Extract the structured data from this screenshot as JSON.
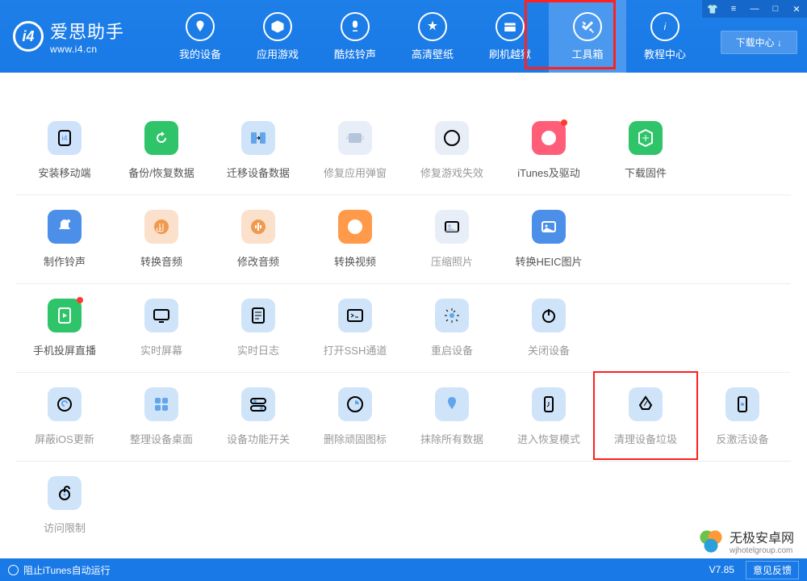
{
  "app": {
    "title": "爱思助手",
    "subtitle": "www.i4.cn"
  },
  "nav": [
    {
      "label": "我的设备"
    },
    {
      "label": "应用游戏"
    },
    {
      "label": "酷炫铃声"
    },
    {
      "label": "高清壁纸"
    },
    {
      "label": "刷机越狱"
    },
    {
      "label": "工具箱"
    },
    {
      "label": "教程中心"
    }
  ],
  "downloadCenter": "下载中心 ↓",
  "rows": [
    [
      {
        "label": "安装移动端",
        "bg": "c-blue-l",
        "icon": "install"
      },
      {
        "label": "备份/恢复数据",
        "bg": "c-green",
        "icon": "backup"
      },
      {
        "label": "迁移设备数据",
        "bg": "c-cyan-l",
        "icon": "migrate"
      },
      {
        "label": "修复应用弹窗",
        "bg": "c-gray",
        "icon": "appleid",
        "dim": true
      },
      {
        "label": "修复游戏失效",
        "bg": "c-gray",
        "icon": "game",
        "dim": true
      },
      {
        "label": "iTunes及驱动",
        "bg": "c-pink",
        "icon": "itunes",
        "dot": true
      },
      {
        "label": "下载固件",
        "bg": "c-green",
        "icon": "firmware"
      }
    ],
    [
      {
        "label": "制作铃声",
        "bg": "c-blue",
        "icon": "ring"
      },
      {
        "label": "转换音频",
        "bg": "c-orange-l",
        "icon": "audio"
      },
      {
        "label": "修改音频",
        "bg": "c-orange-l",
        "icon": "audio2"
      },
      {
        "label": "转换视频",
        "bg": "c-orange",
        "icon": "video"
      },
      {
        "label": "压缩照片",
        "bg": "c-gray",
        "icon": "photo",
        "dim": true
      },
      {
        "label": "转换HEIC图片",
        "bg": "c-blue",
        "icon": "heic"
      }
    ],
    [
      {
        "label": "手机投屏直播",
        "bg": "c-green2",
        "icon": "cast",
        "dot": true
      },
      {
        "label": "实时屏幕",
        "bg": "c-cyan-l",
        "icon": "screen",
        "dim": true
      },
      {
        "label": "实时日志",
        "bg": "c-cyan-l",
        "icon": "log",
        "dim": true
      },
      {
        "label": "打开SSH通道",
        "bg": "c-cyan-l",
        "icon": "ssh",
        "dim": true
      },
      {
        "label": "重启设备",
        "bg": "c-cyan-l",
        "icon": "restart",
        "dim": true
      },
      {
        "label": "关闭设备",
        "bg": "c-cyan-l",
        "icon": "shutdown",
        "dim": true
      }
    ],
    [
      {
        "label": "屏蔽iOS更新",
        "bg": "c-cyan-l",
        "icon": "block",
        "dim": true
      },
      {
        "label": "整理设备桌面",
        "bg": "c-cyan-l",
        "icon": "desk",
        "dim": true
      },
      {
        "label": "设备功能开关",
        "bg": "c-cyan-l",
        "icon": "toggle",
        "dim": true
      },
      {
        "label": "删除顽固图标",
        "bg": "c-cyan-l",
        "icon": "delicon",
        "dim": true
      },
      {
        "label": "抹除所有数据",
        "bg": "c-cyan-l",
        "icon": "erase",
        "dim": true
      },
      {
        "label": "进入恢复模式",
        "bg": "c-cyan-l",
        "icon": "recov",
        "dim": true
      },
      {
        "label": "清理设备垃圾",
        "bg": "c-cyan-l",
        "icon": "clean",
        "dim": true,
        "frame": true
      },
      {
        "label": "反激活设备",
        "bg": "c-cyan-l",
        "icon": "deact",
        "dim": true
      }
    ],
    [
      {
        "label": "访问限制",
        "bg": "c-cyan-l",
        "icon": "lock",
        "dim": true
      }
    ]
  ],
  "footer": {
    "itunes": "阻止iTunes自动运行",
    "version": "V7.85",
    "feedback": "意见反馈"
  },
  "watermark": {
    "brand": "无极安卓网",
    "url": "wjhotelgroup.com"
  }
}
